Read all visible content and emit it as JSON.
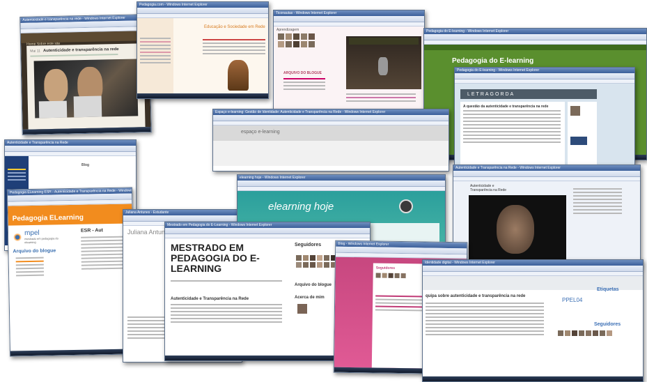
{
  "windows": {
    "w1": {
      "title": "Autenticidade e transparência na rede - Windows Internet Explorer",
      "post_date": "Mai 11",
      "post_title": "Autenticidade e transparência na rede",
      "nav": "Home    Sobre este site"
    },
    "w2": {
      "title": "Pedagogia.com - Windows Internet Explorer",
      "header": "Educação e Sociedade em Rede"
    },
    "w3": {
      "title": "Ticonautas - Windows Internet Explorer",
      "heading": "ARQUIVO DO BLOGUE",
      "text": "Aprendizagem"
    },
    "w4": {
      "title": "Pedagogia do E-learning - Windows Internet Explorer",
      "blog_title": "Pedagogia do E-learning",
      "logo": "LETRAGORDA",
      "post_title": "A questão da autenticidade e transparência na rede"
    },
    "w5": {
      "title": "Espaço e-learning: Gestão de Identidade: Autenticidade e Transparência na Rede - Windows Internet Explorer",
      "header": "espaço e-learning"
    },
    "w6": {
      "title": "Autenticidade e Transparência na Rede",
      "label": "Blog"
    },
    "w7": {
      "title": "Pedagogia ELearning ESR - Autenticidade e Transparência na Rede - Windows Internet Explorer",
      "blog_title": "Pedagogia ELearning",
      "logo": "mpel",
      "logo_sub": "mestrado em pedagogia do elearning",
      "heading": "Arquivo do blogue",
      "side_title": "ESR - Aut"
    },
    "w8": {
      "title": "Juliana Antunes - Estudante",
      "header": "Juliana Antunes - Estudante on-li"
    },
    "w9": {
      "title": "elearning hoje - Windows Internet Explorer",
      "header": "elearning hoje"
    },
    "w10": {
      "title": "Autenticidade e Transparência na Rede - Windows Internet Explorer",
      "side_title": "Autenticidade e Transparência na Rede"
    },
    "w11": {
      "title": "Mestrado em Pedagogia do E-Learning - Windows Internet Explorer",
      "blog_title": "MESTRADO EM PEDAGOGIA DO E-LEARNING",
      "post_title": "Autenticidade e Transparência na Rede",
      "side_seguidores": "Seguidores",
      "side_arquivo": "Arquivo do blogue",
      "side_acerca": "Acerca de mim"
    },
    "w12": {
      "title": "Blog - Windows Internet Explorer",
      "label": "Seguidores"
    },
    "w13": {
      "title": "Identidade digital - Windows Internet Explorer",
      "post_title": "quipa sobre autenticidade e transparência na rede",
      "side_etiquetas": "Etiquetas",
      "tag1": "PPEL04",
      "side_seguidores": "Seguidores"
    }
  },
  "colors": {
    "titlebar": "#3b5f9a",
    "taskbar": "#1a2438",
    "green_header": "#6aa84f",
    "orange_header": "#f28c1e",
    "teal_header": "#29a3a3",
    "pink_bg": "#d24b8c"
  }
}
